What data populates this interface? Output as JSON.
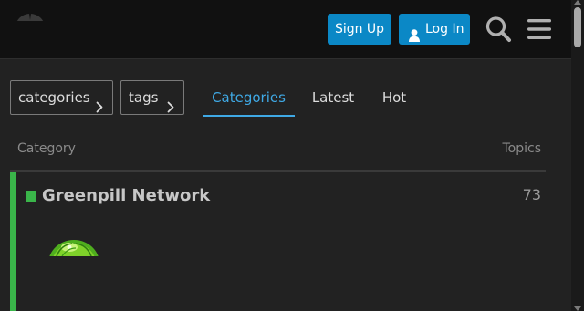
{
  "header": {
    "logo_icon": "site-logo-icon",
    "signup_label": "Sign Up",
    "login_label": "Log In",
    "login_icon": "user-icon",
    "search_icon": "search-icon",
    "menu_icon": "hamburger-icon",
    "accent_color": "#0b88c6"
  },
  "filters": {
    "categories_label": "categories",
    "tags_label": "tags",
    "chevron_icon": "chevron-right-icon"
  },
  "nav": {
    "tabs": [
      {
        "label": "Categories",
        "active": true
      },
      {
        "label": "Latest",
        "active": false
      },
      {
        "label": "Hot",
        "active": false
      }
    ],
    "active_color": "#3fa9e5"
  },
  "table": {
    "headers": {
      "category": "Category",
      "topics": "Topics"
    },
    "rows": [
      {
        "name": "Greenpill Network",
        "topics": "73",
        "color": "#3ab54a",
        "logo_icon": "greenpill-logo-icon"
      }
    ]
  }
}
